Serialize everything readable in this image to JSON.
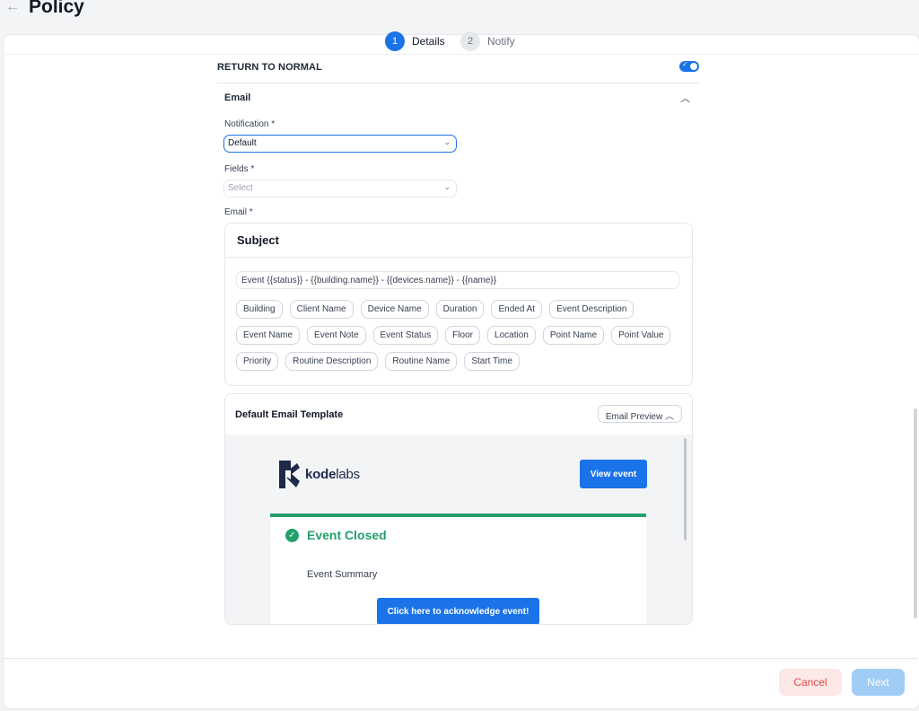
{
  "header": {
    "back_icon": "arrow-left-icon",
    "title": "Policy"
  },
  "stepper": [
    {
      "number": "1",
      "label": "Details",
      "active": true
    },
    {
      "number": "2",
      "label": "Notify",
      "active": false
    }
  ],
  "return_to_normal": {
    "label": "RETURN TO NORMAL",
    "enabled": true
  },
  "email_section": {
    "title": "Email",
    "notification": {
      "label": "Notification *",
      "value": "Default"
    },
    "fields": {
      "label": "Fields *",
      "placeholder": "Select"
    },
    "email_label": "Email *"
  },
  "subject": {
    "title": "Subject",
    "value": "Event {{status}} - {{building.name}} - {{devices.name}} - {{name}}",
    "chips_row1": [
      "Building",
      "Client Name",
      "Device Name",
      "Duration",
      "Ended At",
      "Event Description"
    ],
    "chips_row2": [
      "Event Name",
      "Event Note",
      "Event Status",
      "Floor",
      "Location",
      "Point Name",
      "Point Value"
    ],
    "chips_row3": [
      "Priority",
      "Routine Description",
      "Routine Name",
      "Start Time"
    ]
  },
  "template": {
    "title": "Default Email Template",
    "preview_button": "Email Preview",
    "logo_text_1": "kode",
    "logo_text_2": "labs",
    "view_event": "View event",
    "event_status": "Event Closed",
    "event_summary": "Event Summary",
    "acknowledge": "Click here to acknowledge event!"
  },
  "footer": {
    "cancel": "Cancel",
    "next": "Next"
  },
  "colors": {
    "primary": "#1a73e8",
    "success": "#22a06b",
    "danger": "#e24c4c"
  }
}
